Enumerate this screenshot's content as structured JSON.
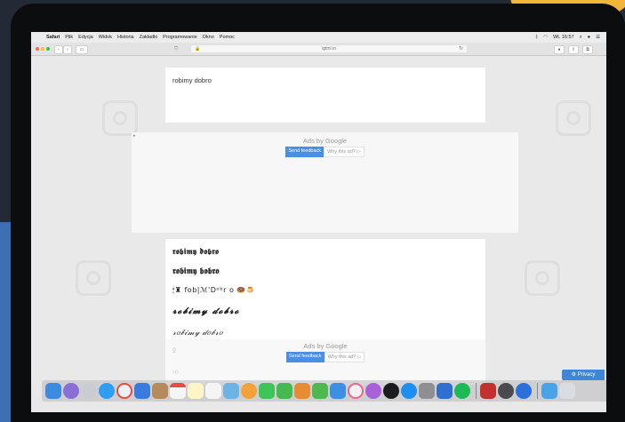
{
  "menubar": {
    "items": [
      "Safari",
      "Plik",
      "Edycja",
      "Widok",
      "Historia",
      "Zakładki",
      "Programowanie",
      "Okno",
      "Pomoc"
    ],
    "clock": "Wt. 16:57",
    "status_icons": [
      "bluetooth-icon",
      "wifi-icon",
      "spotlight-icon",
      "siri-icon",
      "notification-icon"
    ]
  },
  "toolbar": {
    "url": "igtml.io"
  },
  "page": {
    "input_text": "robimy dobro",
    "ad_title": "Ads by Google",
    "ad_send_feedback": "Send feedback",
    "ad_why": "Why this ad? ▷",
    "results": [
      "𝖗𝖔𝖇𝖎𝖒𝖞 𝖉𝖔𝖇𝖗𝖔",
      "𝖗𝖔𝖇𝖎𝖒𝖞 𝖇𝖔𝖇𝖗𝖔",
      "🕯♜ fob|ℳ'Dᵒᵇr o 🍩🍮",
      "𝓻𝓸𝓫𝓲𝓶𝔂 𝓭𝓸𝓫𝓻𝓸",
      "𝓇𝑜𝒷𝒾𝓂𝓎 𝒹𝑜𝒷𝓇𝑜",
      "ꝿ",
      "ro"
    ],
    "privacy": "Privacy"
  },
  "colors": {
    "accent_blue": "#4a8fe6",
    "privacy_blue": "#3f86d8"
  }
}
